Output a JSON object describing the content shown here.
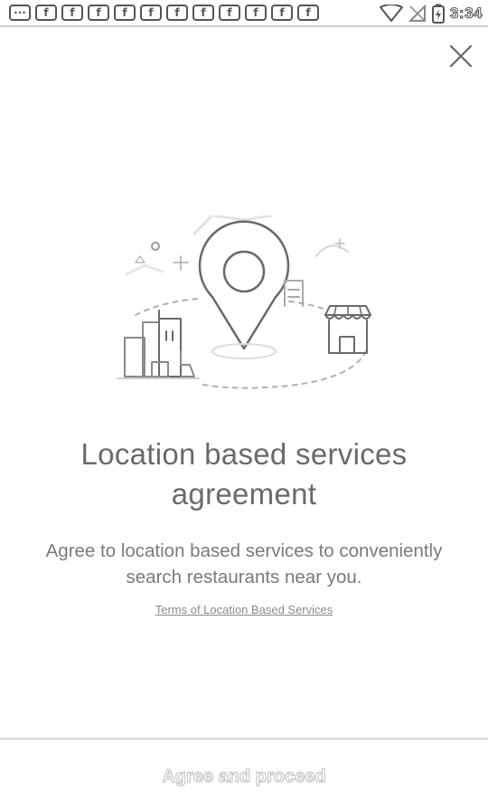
{
  "status_bar": {
    "time": "3:34",
    "notification_icons": [
      "···",
      "f",
      "f",
      "f",
      "f",
      "f",
      "f",
      "f",
      "f",
      "f",
      "f",
      "f"
    ]
  },
  "dialog": {
    "title": "Location based services agreement",
    "description": "Agree to location based services to conveniently search restaurants near you.",
    "terms_link": "Terms of Location Based Services",
    "proceed_button": "Agree and proceed"
  },
  "icons": {
    "close": "close-icon",
    "illustration": "location-map-illustration"
  },
  "colors": {
    "text": "#6a6a6a",
    "divider": "#d6d6d6",
    "icon_stroke": "#777777"
  }
}
